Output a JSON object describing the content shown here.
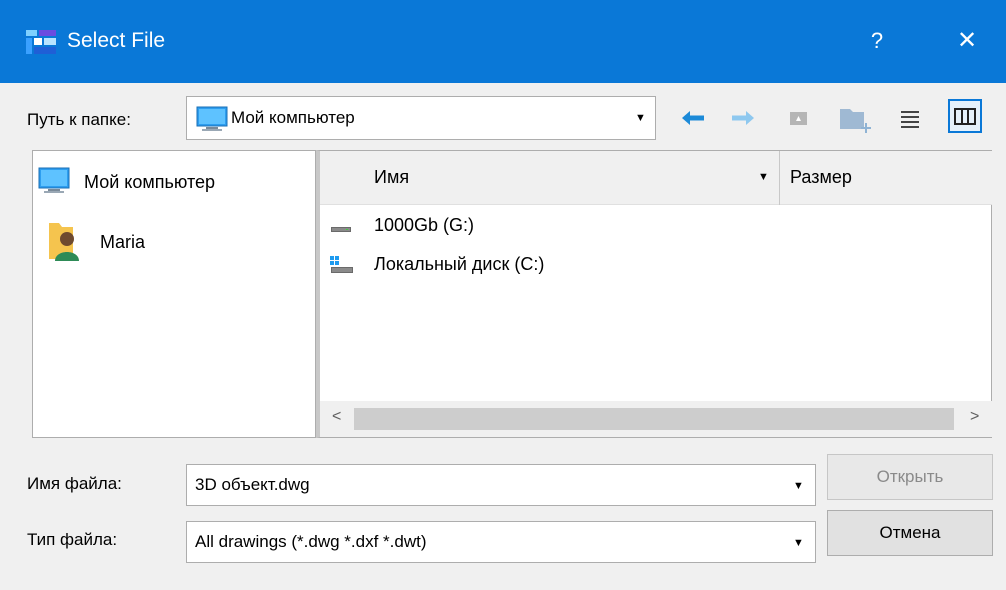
{
  "window": {
    "title": "Select File",
    "help": "?",
    "close": "✕"
  },
  "path": {
    "label": "Путь к папке:",
    "value": "Мой компьютер"
  },
  "toolbar": {
    "back_icon": "back-arrow-icon",
    "forward_icon": "forward-arrow-icon",
    "up_icon": "up-folder-icon",
    "new_folder_icon": "new-folder-icon",
    "list_view_icon": "list-view-icon",
    "details_view_icon": "details-view-icon"
  },
  "places": [
    {
      "label": "Мой компьютер",
      "icon": "computer-icon"
    },
    {
      "label": "Maria",
      "icon": "user-folder-icon"
    }
  ],
  "files": {
    "columns": [
      "Имя",
      "Размер"
    ],
    "rows": [
      {
        "name": "1000Gb (G:)",
        "icon": "drive-icon"
      },
      {
        "name": "Локальный диск (C:)",
        "icon": "system-drive-icon"
      }
    ]
  },
  "filename": {
    "label": "Имя файла:",
    "value": "3D объект.dwg"
  },
  "filetype": {
    "label": "Тип файла:",
    "value": "All drawings (*.dwg *.dxf *.dwt)"
  },
  "buttons": {
    "open": "Открыть",
    "cancel": "Отмена"
  },
  "colors": {
    "accent": "#0a78d7",
    "titlebar_text": "#ffffff",
    "disabled_text": "#8a8a8a"
  }
}
